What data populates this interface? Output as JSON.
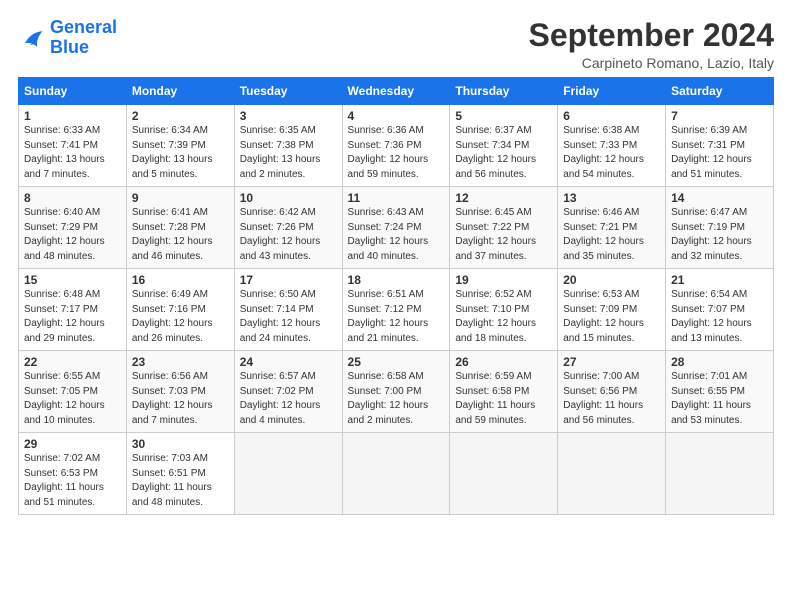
{
  "logo": {
    "text_general": "General",
    "text_blue": "Blue"
  },
  "header": {
    "month": "September 2024",
    "location": "Carpineto Romano, Lazio, Italy"
  },
  "weekdays": [
    "Sunday",
    "Monday",
    "Tuesday",
    "Wednesday",
    "Thursday",
    "Friday",
    "Saturday"
  ],
  "weeks": [
    [
      {
        "day": "1",
        "sunrise": "6:33 AM",
        "sunset": "7:41 PM",
        "daylight": "13 hours and 7 minutes."
      },
      {
        "day": "2",
        "sunrise": "6:34 AM",
        "sunset": "7:39 PM",
        "daylight": "13 hours and 5 minutes."
      },
      {
        "day": "3",
        "sunrise": "6:35 AM",
        "sunset": "7:38 PM",
        "daylight": "13 hours and 2 minutes."
      },
      {
        "day": "4",
        "sunrise": "6:36 AM",
        "sunset": "7:36 PM",
        "daylight": "12 hours and 59 minutes."
      },
      {
        "day": "5",
        "sunrise": "6:37 AM",
        "sunset": "7:34 PM",
        "daylight": "12 hours and 56 minutes."
      },
      {
        "day": "6",
        "sunrise": "6:38 AM",
        "sunset": "7:33 PM",
        "daylight": "12 hours and 54 minutes."
      },
      {
        "day": "7",
        "sunrise": "6:39 AM",
        "sunset": "7:31 PM",
        "daylight": "12 hours and 51 minutes."
      }
    ],
    [
      {
        "day": "8",
        "sunrise": "6:40 AM",
        "sunset": "7:29 PM",
        "daylight": "12 hours and 48 minutes."
      },
      {
        "day": "9",
        "sunrise": "6:41 AM",
        "sunset": "7:28 PM",
        "daylight": "12 hours and 46 minutes."
      },
      {
        "day": "10",
        "sunrise": "6:42 AM",
        "sunset": "7:26 PM",
        "daylight": "12 hours and 43 minutes."
      },
      {
        "day": "11",
        "sunrise": "6:43 AM",
        "sunset": "7:24 PM",
        "daylight": "12 hours and 40 minutes."
      },
      {
        "day": "12",
        "sunrise": "6:45 AM",
        "sunset": "7:22 PM",
        "daylight": "12 hours and 37 minutes."
      },
      {
        "day": "13",
        "sunrise": "6:46 AM",
        "sunset": "7:21 PM",
        "daylight": "12 hours and 35 minutes."
      },
      {
        "day": "14",
        "sunrise": "6:47 AM",
        "sunset": "7:19 PM",
        "daylight": "12 hours and 32 minutes."
      }
    ],
    [
      {
        "day": "15",
        "sunrise": "6:48 AM",
        "sunset": "7:17 PM",
        "daylight": "12 hours and 29 minutes."
      },
      {
        "day": "16",
        "sunrise": "6:49 AM",
        "sunset": "7:16 PM",
        "daylight": "12 hours and 26 minutes."
      },
      {
        "day": "17",
        "sunrise": "6:50 AM",
        "sunset": "7:14 PM",
        "daylight": "12 hours and 24 minutes."
      },
      {
        "day": "18",
        "sunrise": "6:51 AM",
        "sunset": "7:12 PM",
        "daylight": "12 hours and 21 minutes."
      },
      {
        "day": "19",
        "sunrise": "6:52 AM",
        "sunset": "7:10 PM",
        "daylight": "12 hours and 18 minutes."
      },
      {
        "day": "20",
        "sunrise": "6:53 AM",
        "sunset": "7:09 PM",
        "daylight": "12 hours and 15 minutes."
      },
      {
        "day": "21",
        "sunrise": "6:54 AM",
        "sunset": "7:07 PM",
        "daylight": "12 hours and 13 minutes."
      }
    ],
    [
      {
        "day": "22",
        "sunrise": "6:55 AM",
        "sunset": "7:05 PM",
        "daylight": "12 hours and 10 minutes."
      },
      {
        "day": "23",
        "sunrise": "6:56 AM",
        "sunset": "7:03 PM",
        "daylight": "12 hours and 7 minutes."
      },
      {
        "day": "24",
        "sunrise": "6:57 AM",
        "sunset": "7:02 PM",
        "daylight": "12 hours and 4 minutes."
      },
      {
        "day": "25",
        "sunrise": "6:58 AM",
        "sunset": "7:00 PM",
        "daylight": "12 hours and 2 minutes."
      },
      {
        "day": "26",
        "sunrise": "6:59 AM",
        "sunset": "6:58 PM",
        "daylight": "11 hours and 59 minutes."
      },
      {
        "day": "27",
        "sunrise": "7:00 AM",
        "sunset": "6:56 PM",
        "daylight": "11 hours and 56 minutes."
      },
      {
        "day": "28",
        "sunrise": "7:01 AM",
        "sunset": "6:55 PM",
        "daylight": "11 hours and 53 minutes."
      }
    ],
    [
      {
        "day": "29",
        "sunrise": "7:02 AM",
        "sunset": "6:53 PM",
        "daylight": "11 hours and 51 minutes."
      },
      {
        "day": "30",
        "sunrise": "7:03 AM",
        "sunset": "6:51 PM",
        "daylight": "11 hours and 48 minutes."
      },
      null,
      null,
      null,
      null,
      null
    ]
  ]
}
